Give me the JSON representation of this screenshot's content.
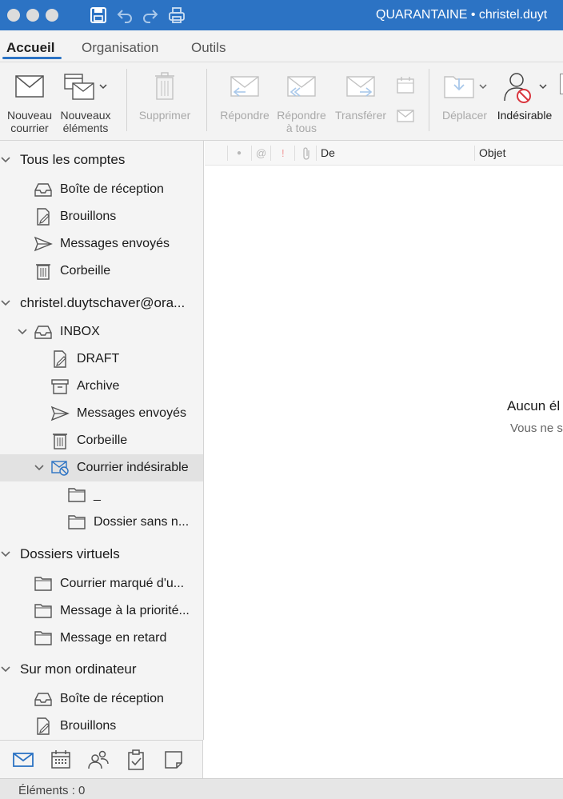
{
  "window": {
    "title": "QUARANTAINE • christel.duyt",
    "toolbar_icons": [
      "save-icon",
      "undo-icon",
      "redo-icon",
      "print-icon"
    ]
  },
  "tabs": [
    "Accueil",
    "Organisation",
    "Outils"
  ],
  "ribbon": {
    "new_mail": [
      "Nouveau",
      "courrier"
    ],
    "new_items": [
      "Nouveaux",
      "éléments"
    ],
    "delete": "Supprimer",
    "reply": "Répondre",
    "reply_all": [
      "Répondre",
      "à tous"
    ],
    "forward": "Transférer",
    "move": "Déplacer",
    "junk": "Indésirable"
  },
  "sidebar": {
    "all_accounts": {
      "title": "Tous les comptes",
      "items": [
        "Boîte de réception",
        "Brouillons",
        "Messages envoyés",
        "Corbeille"
      ]
    },
    "account": {
      "title": "christel.duytschaver@ora...",
      "inbox": "INBOX",
      "items": [
        "DRAFT",
        "Archive",
        "Messages envoyés",
        "Corbeille"
      ],
      "junk": "Courrier indésirable",
      "junk_subfolders": [
        "_",
        "Dossier sans n..."
      ]
    },
    "smart_folders": {
      "title": "Dossiers virtuels",
      "items": [
        "Courrier marqué d'u...",
        "Message à la priorité...",
        "Message en retard"
      ]
    },
    "on_my_computer": {
      "title": "Sur mon ordinateur",
      "items": [
        "Boîte de réception",
        "Brouillons"
      ]
    }
  },
  "bottom_nav": [
    "mail-icon",
    "calendar-icon",
    "people-icon",
    "tasks-icon",
    "notes-icon"
  ],
  "list": {
    "columns": [
      "De",
      "Objet"
    ],
    "column_icons": [
      "●",
      "@",
      "!"
    ],
    "empty_title": "Aucun él",
    "empty_sub": "Vous ne s"
  },
  "status": "Éléments : 0",
  "colors": {
    "accent": "#2c73c4",
    "sidebar_bg": "#f4f4f4",
    "selected_row": "#e2e2e2"
  }
}
